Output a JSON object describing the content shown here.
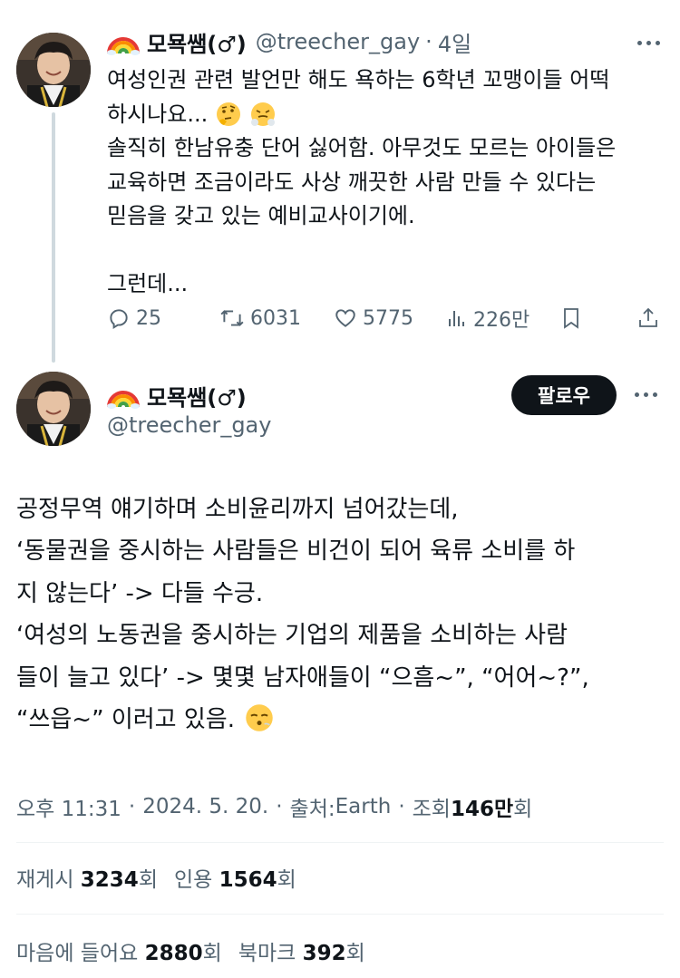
{
  "tweet1": {
    "author_name": "모묙쌤(♂)",
    "handle": "@treecher_gay",
    "time": "4일",
    "lines": [
      "여성인권 관련 발언만 해도 욕하는 6학년 꼬맹이들 어떡",
      "하시나요...",
      "솔직히 한남유충 단어 싫어함. 아무것도 모르는 아이들은",
      "교육하면 조금이라도 사상 깨끗한 사람 만들 수 있다는",
      "믿음을 갖고 있는 예비교사이기에.",
      "",
      "그런데..."
    ],
    "emojis": [
      "thinking-face",
      "face-with-steam"
    ],
    "actions": {
      "replies": "25",
      "retweets": "6031",
      "likes": "5775",
      "views": "226만"
    }
  },
  "tweet2": {
    "author_name": "모묙쌤(♂)",
    "handle": "@treecher_gay",
    "follow_label": "팔로우",
    "lines": [
      "공정무역 얘기하며 소비윤리까지 넘어갔는데,",
      "‘동물권을 중시하는 사람들은 비건이 되어 육류 소비를 하",
      "지 않는다’ -> 다들 수긍.",
      "‘여성의 노동권을 중시하는 기업의 제품을 소비하는 사람",
      "들이 늘고 있다’ -> 몇몇 남자애들이 “으흠~”, “어어~?”,",
      "“쓰읍~” 이러고 있음."
    ],
    "emoji": "face-exhaling",
    "meta": {
      "time": "오후 11:31",
      "date": "2024. 5. 20.",
      "source_prefix": "출처: ",
      "source": "Earth",
      "views_prefix": "조회 ",
      "views": "146만",
      "views_suffix": "회"
    },
    "stats": {
      "retweets_label": "재게시 ",
      "retweets": "3234",
      "quotes_label": "인용 ",
      "quotes": "1564",
      "likes_label": "마음에 들어요 ",
      "likes": "2880",
      "bookmarks_label": "북마크 ",
      "bookmarks": "392",
      "suffix": "회"
    }
  },
  "colors": {
    "text": "#0f1419",
    "secondary": "#536471",
    "follow_bg": "#0f1419",
    "divider": "#eff3f4",
    "thread_line": "#cfd9de"
  }
}
